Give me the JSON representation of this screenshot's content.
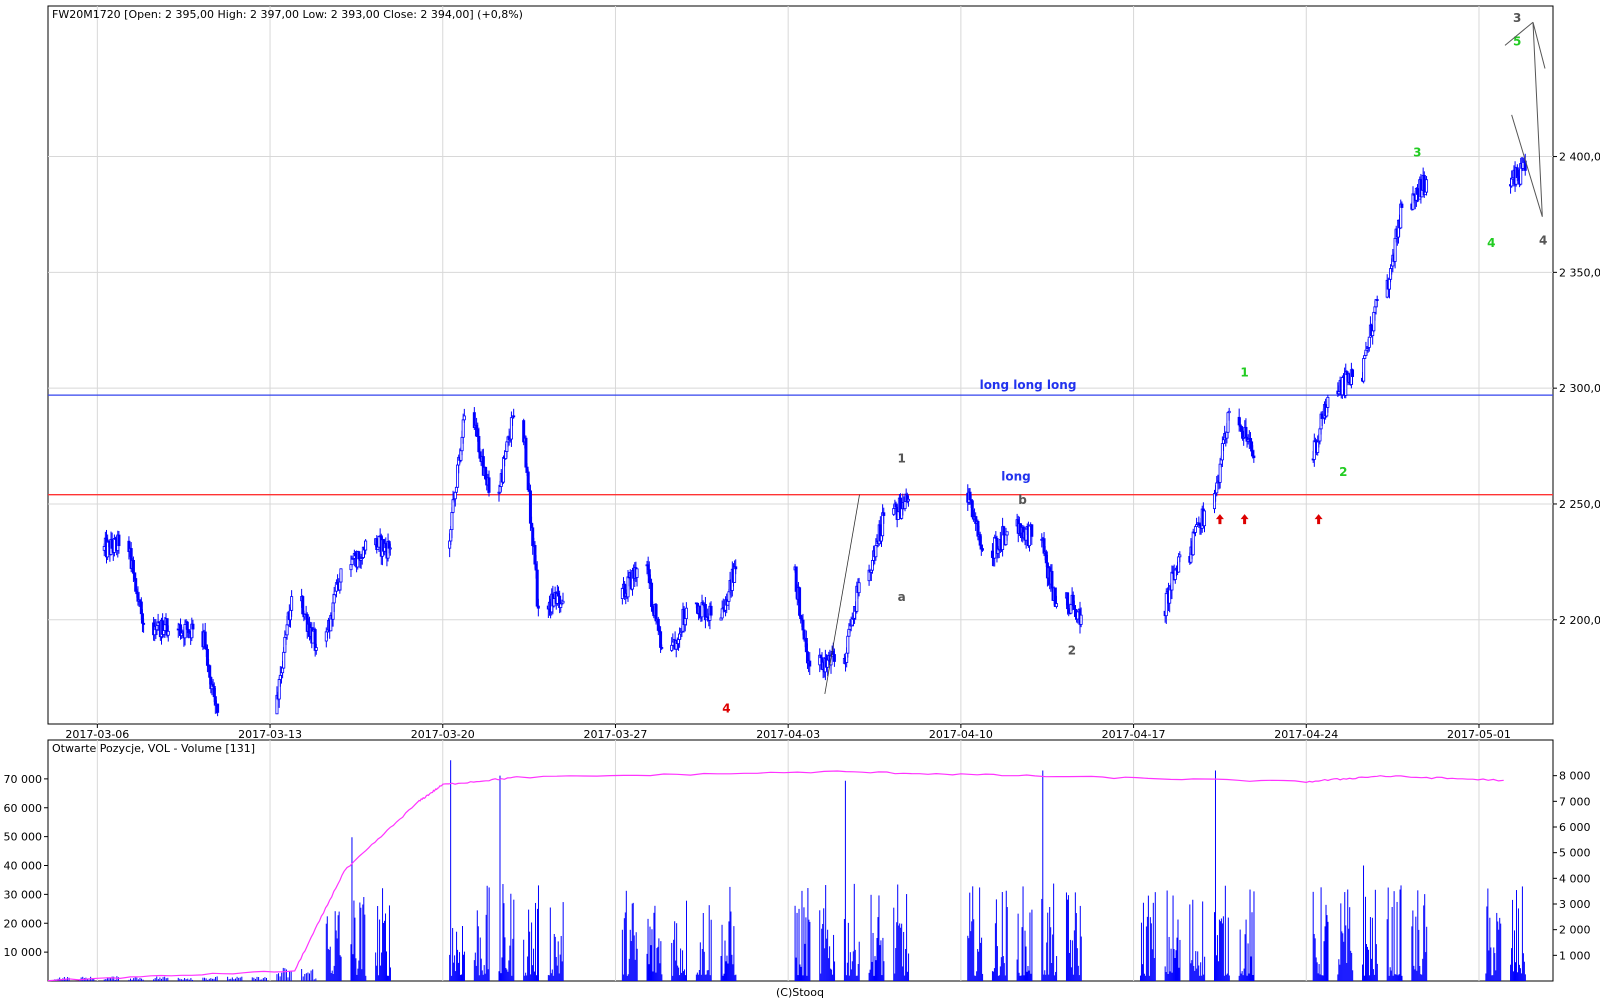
{
  "main_header": "FW20M1720 [Open: 2 395,00  High: 2 397,00  Low: 2 393,00  Close: 2 394,00] (+0,8%)",
  "volume_header": "Otwarte Pozycje, VOL - Volume [131]",
  "copyright": "(C)Stooq",
  "colors": {
    "candle": "#0000ff",
    "support_line": "#ff3333",
    "resistance_line": "#3344ee",
    "open_interest": "#ff33ff",
    "volume": "#0000ff",
    "grid": "#d8d8d8",
    "wave_gray": "#555555",
    "wave_green": "#22cc22",
    "wave_red": "#dd0000",
    "label_blue": "#2233ee"
  },
  "chart_data": [
    {
      "type": "candlestick",
      "x_ticks": [
        "2017-03-06",
        "2017-03-13",
        "2017-03-20",
        "2017-03-27",
        "2017-04-03",
        "2017-04-10",
        "2017-04-17",
        "2017-04-24",
        "2017-05-01"
      ],
      "y_ticks": [
        "2 200,0",
        "2 250,0",
        "2 300,0",
        "2 350,0",
        "2 400,0"
      ],
      "ylim": [
        2155,
        2465
      ],
      "xlim": [
        "2017-03-04",
        "2017-05-04"
      ],
      "grid": true,
      "session_closes": [
        {
          "x": "2017-03-06",
          "close": 2232
        },
        {
          "x": "2017-03-07",
          "close": 2198
        },
        {
          "x": "2017-03-08",
          "close": 2195
        },
        {
          "x": "2017-03-09",
          "close": 2196
        },
        {
          "x": "2017-03-10",
          "close": 2160
        },
        {
          "x": "2017-03-13",
          "close": 2210
        },
        {
          "x": "2017-03-14",
          "close": 2188
        },
        {
          "x": "2017-03-15",
          "close": 2222
        },
        {
          "x": "2017-03-16",
          "close": 2234
        },
        {
          "x": "2017-03-17",
          "close": 2231
        },
        {
          "x": "2017-03-20",
          "close": 2288
        },
        {
          "x": "2017-03-21",
          "close": 2255
        },
        {
          "x": "2017-03-22",
          "close": 2288
        },
        {
          "x": "2017-03-23",
          "close": 2205
        },
        {
          "x": "2017-03-24",
          "close": 2208
        },
        {
          "x": "2017-03-27",
          "close": 2222
        },
        {
          "x": "2017-03-28",
          "close": 2188
        },
        {
          "x": "2017-03-29",
          "close": 2205
        },
        {
          "x": "2017-03-30",
          "close": 2202
        },
        {
          "x": "2017-03-31",
          "close": 2222
        },
        {
          "x": "2017-04-03",
          "close": 2180
        },
        {
          "x": "2017-04-04",
          "close": 2182
        },
        {
          "x": "2017-04-05",
          "close": 2216
        },
        {
          "x": "2017-04-06",
          "close": 2245
        },
        {
          "x": "2017-04-07",
          "close": 2252
        },
        {
          "x": "2017-04-10",
          "close": 2230
        },
        {
          "x": "2017-04-11",
          "close": 2238
        },
        {
          "x": "2017-04-12",
          "close": 2236
        },
        {
          "x": "2017-04-13",
          "close": 2207
        },
        {
          "x": "2017-04-14",
          "close": 2202
        },
        {
          "x": "2017-04-18",
          "close": 2228
        },
        {
          "x": "2017-04-19",
          "close": 2247
        },
        {
          "x": "2017-04-20",
          "close": 2290
        },
        {
          "x": "2017-04-21",
          "close": 2270
        },
        {
          "x": "2017-04-24",
          "close": 2296
        },
        {
          "x": "2017-04-25",
          "close": 2305
        },
        {
          "x": "2017-04-26",
          "close": 2338
        },
        {
          "x": "2017-04-27",
          "close": 2378
        },
        {
          "x": "2017-04-28",
          "close": 2390
        },
        {
          "x": "2017-05-02",
          "close": 2394
        }
      ],
      "horizontal_lines": [
        {
          "y": 2297,
          "label": "long long long"
        },
        {
          "y": 2254,
          "label": "long"
        }
      ],
      "wave_labels": [
        {
          "text": "4",
          "x": "2017-03-31",
          "y": 2160,
          "color": "red"
        },
        {
          "text": "1",
          "x": "2017-04-07",
          "y": 2268,
          "color": "gray"
        },
        {
          "text": "a",
          "x": "2017-04-07",
          "y": 2208,
          "color": "gray"
        },
        {
          "text": "b",
          "x": "2017-04-12",
          "y": 2250,
          "color": "gray"
        },
        {
          "text": "2",
          "x": "2017-04-14",
          "y": 2185,
          "color": "gray"
        },
        {
          "text": "1",
          "x": "2017-04-21",
          "y": 2305,
          "color": "green"
        },
        {
          "text": "2",
          "x": "2017-04-25",
          "y": 2262,
          "color": "green"
        },
        {
          "text": "3",
          "x": "2017-04-28",
          "y": 2400,
          "color": "green"
        },
        {
          "text": "4",
          "x": "2017-05-01",
          "y": 2361,
          "color": "green"
        },
        {
          "text": "5",
          "x": "2017-05-02",
          "y": 2448,
          "color": "green"
        },
        {
          "text": "3",
          "x": "2017-05-02",
          "y": 2458,
          "color": "gray"
        },
        {
          "text": "4",
          "x": "2017-05-03",
          "y": 2362,
          "color": "gray"
        }
      ],
      "arrows": [
        {
          "x": "2017-04-20",
          "y": 2243
        },
        {
          "x": "2017-04-21",
          "y": 2243
        },
        {
          "x": "2017-04-24",
          "y": 2243
        }
      ]
    },
    {
      "type": "bar+line",
      "series": [
        {
          "name": "Otwarte Pozycje",
          "type": "line",
          "axis": "left"
        },
        {
          "name": "VOL - Volume",
          "type": "bar",
          "axis": "right"
        }
      ],
      "left_ticks": [
        "10 000",
        "20 000",
        "30 000",
        "40 000",
        "50 000",
        "60 000",
        "70 000"
      ],
      "right_ticks": [
        "1 000",
        "2 000",
        "3 000",
        "4 000",
        "5 000",
        "6 000",
        "7 000",
        "8 000"
      ],
      "left_ylim": [
        0,
        80000
      ],
      "right_ylim": [
        0,
        9000
      ],
      "open_interest": [
        {
          "x": "2017-03-04",
          "v": 200
        },
        {
          "x": "2017-03-14",
          "v": 3500
        },
        {
          "x": "2017-03-16",
          "v": 38000
        },
        {
          "x": "2017-03-19",
          "v": 62000
        },
        {
          "x": "2017-03-20",
          "v": 68000
        },
        {
          "x": "2017-03-23",
          "v": 70500
        },
        {
          "x": "2017-04-05",
          "v": 72500
        },
        {
          "x": "2017-04-13",
          "v": 71000
        },
        {
          "x": "2017-04-24",
          "v": 69000
        },
        {
          "x": "2017-04-27",
          "v": 71000
        },
        {
          "x": "2017-05-02",
          "v": 69500
        }
      ],
      "volume_spikes": [
        {
          "x": "2017-03-16",
          "v": 5600
        },
        {
          "x": "2017-03-20",
          "v": 8600
        },
        {
          "x": "2017-03-22",
          "v": 8000
        },
        {
          "x": "2017-04-05",
          "v": 7800
        },
        {
          "x": "2017-04-13",
          "v": 8200
        },
        {
          "x": "2017-04-20",
          "v": 8200
        },
        {
          "x": "2017-04-26",
          "v": 4500
        }
      ]
    }
  ]
}
